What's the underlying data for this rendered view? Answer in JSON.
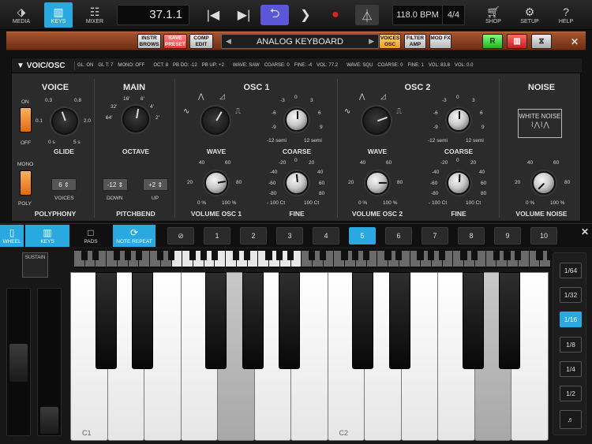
{
  "topbar": {
    "media": "MEDIA",
    "keys": "KEYS",
    "mixer": "MIXER",
    "position": "37.1.1",
    "tempo": "118.0 BPM",
    "signature": "4/4",
    "shop": "SHOP",
    "setup": "SETUP",
    "help": "HELP"
  },
  "header": {
    "instr_brows": "INSTR BROWS",
    "save_preset": "SAVE PRESET",
    "comp_edit": "COMP EDIT",
    "preset_name": "ANALOG KEYBOARD",
    "voices_osc": "VOICES OSC",
    "filter_amp": "FILTER AMP",
    "mod_fx": "MOD FX",
    "r": "R"
  },
  "panel": {
    "title": "VOIC/OSC",
    "status": [
      "GL: ON",
      "GL T: 7",
      "MONO: OFF",
      "OCT: 8",
      "PB DO: -12",
      "PB UP: +2",
      "WAVE: SAW",
      "COARSE: 0",
      "FINE: -4",
      "VOL: 77.2",
      "WAVE: SQU",
      "COARSE: 0",
      "FINE: 1",
      "VOL: 83.8",
      "VOL: 0.0"
    ],
    "voice": {
      "title": "VOICE",
      "on": "ON",
      "off": "OFF",
      "glide": "GLIDE",
      "g_03": "0.3",
      "g_08": "0.8",
      "g_01": "0.1",
      "g_20": "2.0",
      "g_0s": "0 s",
      "g_5s": "5 s",
      "mono": "MONO",
      "poly": "POLY",
      "voices_val": "6",
      "voices": "VOICES",
      "polyphony": "POLYPHONY"
    },
    "main": {
      "title": "MAIN",
      "o16": "16'",
      "o8": "8'",
      "o32": "32'",
      "o4": "4'",
      "o64": "64'",
      "o2": "2'",
      "octave": "OCTAVE",
      "down_val": "-12",
      "up_val": "+2",
      "down": "DOWN",
      "up": "UP",
      "pitchbend": "PITCHBEND"
    },
    "osc1": {
      "title": "OSC 1",
      "wave": "WAVE",
      "coarse": "COARSE",
      "vol": "VOLUME OSC 1",
      "fine": "FINE"
    },
    "osc2": {
      "title": "OSC 2",
      "wave": "WAVE",
      "coarse": "COARSE",
      "vol": "VOLUME OSC 2",
      "fine": "FINE"
    },
    "coarse_ticks": [
      "-3",
      "0",
      "3",
      "-6",
      "6",
      "-9",
      "9",
      "-12 semi",
      "12 semi"
    ],
    "vol_ticks": [
      "40",
      "60",
      "20",
      "80",
      "0 %",
      "100 %"
    ],
    "fine_ticks": [
      "-20",
      "0",
      "20",
      "-40",
      "40",
      "-60",
      "60",
      "-80",
      "80",
      "- 100 Ct",
      "100 Ct"
    ],
    "noise": {
      "title": "NOISE",
      "white_noise": "WHITE NOISE",
      "vol": "VOLUME NOISE",
      "t40": "40",
      "t60": "60",
      "t20": "20",
      "t80": "80",
      "t0": "0 %",
      "t100": "100 %"
    }
  },
  "strip": {
    "wheel": "WHEEL",
    "keys": "KEYS",
    "pads": "PADS",
    "note_repeat": "NOTE REPEAT",
    "numbers": [
      "1",
      "2",
      "3",
      "4",
      "5",
      "6",
      "7",
      "8",
      "9",
      "10"
    ],
    "selected": "5"
  },
  "keyboard": {
    "sustain": "SUSTAIN",
    "c1": "C1",
    "c2": "C2"
  },
  "note_values": [
    "1/64",
    "1/32",
    "1/16",
    "1/8",
    "1/4",
    "1/2"
  ],
  "note_selected": "1/16",
  "colors": {
    "accent": "#2aa9e0",
    "loop": "#5c57d8",
    "record": "#e02020"
  }
}
